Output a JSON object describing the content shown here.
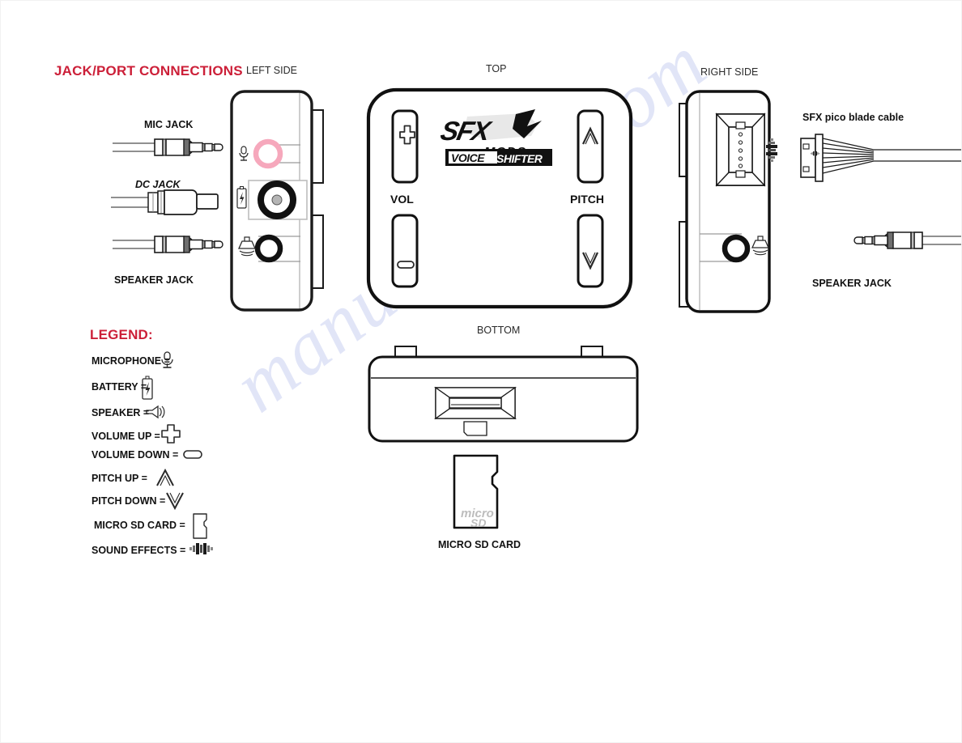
{
  "document": {
    "watermark": "manualshive.com",
    "section_heading": "JACK/PORT CONNECTIONS",
    "legend_heading": "LEGEND:"
  },
  "view_labels": {
    "left": "LEFT SIDE",
    "top": "TOP",
    "right": "RIGHT SIDE",
    "bottom": "BOTTOM"
  },
  "jacks": {
    "mic": "MIC JACK",
    "dc": "DC JACK",
    "speaker": "SPEAKER JACK"
  },
  "controls": {
    "vol": "VOL",
    "pitch": "PITCH"
  },
  "logo": {
    "brand": "SFX",
    "sub": "MODS",
    "product_a": "VOICE",
    "product_b": "SHIFTER"
  },
  "accessories": {
    "pico_cable": "SFX pico blade cable",
    "speaker_jack": "SPEAKER JACK",
    "micro_sd": "MICRO SD CARD",
    "sd_face_a": "micro",
    "sd_face_b": "SD"
  },
  "legend": {
    "items": [
      {
        "label": "MICROPHONE =",
        "icon": "microphone-icon"
      },
      {
        "label": "BATTERY =",
        "icon": "battery-icon"
      },
      {
        "label": "SPEAKER =",
        "icon": "speaker-icon"
      },
      {
        "label": "VOLUME UP =",
        "icon": "plus-icon"
      },
      {
        "label": "VOLUME DOWN =",
        "icon": "minus-icon"
      },
      {
        "label": "PITCH UP =",
        "icon": "chevron-up-icon"
      },
      {
        "label": "PITCH DOWN =",
        "icon": "chevron-down-icon"
      },
      {
        "label": "MICRO SD CARD =",
        "icon": "sd-card-icon"
      },
      {
        "label": "SOUND EFFECTS =",
        "icon": "sound-effects-icon"
      }
    ]
  },
  "colors": {
    "heading_red": "#cc1f38",
    "mic_port_pink": "#f6a8bc",
    "outline": "#111111",
    "watermark": "#c9d0f2"
  }
}
